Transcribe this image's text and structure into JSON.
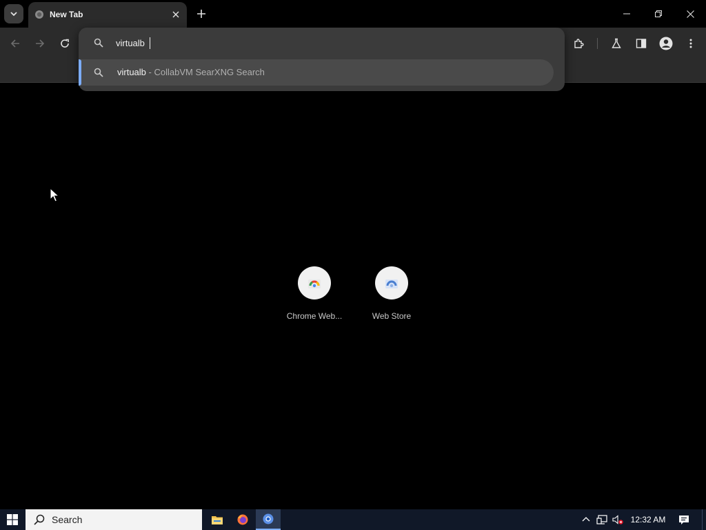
{
  "tabstrip": {
    "tab_title": "New Tab",
    "tab_search_icon": "chevron-down-icon",
    "close_icon": "close-icon",
    "new_tab_icon": "plus-icon"
  },
  "window_controls": [
    "minimize-icon",
    "restore-icon",
    "close-icon"
  ],
  "toolbar": {
    "left_icons": [
      "back-arrow-icon",
      "forward-arrow-icon",
      "reload-icon"
    ],
    "right_icons": [
      "extensions-icon",
      "labs-flask-icon",
      "side-panel-icon",
      "profile-icon",
      "more-menu-icon"
    ]
  },
  "omnibox": {
    "value": "virtualb",
    "suggestions": [
      {
        "query": "virtualb",
        "description": " - CollabVM SearXNG Search",
        "icon": "search-icon"
      }
    ]
  },
  "shortcuts": [
    {
      "label": "Chrome Web...",
      "icon": "chrome-web-store-icon"
    },
    {
      "label": "Web Store",
      "icon": "web-store-icon"
    }
  ],
  "taskbar": {
    "search_placeholder": "Search",
    "apps": [
      "file-explorer-icon",
      "firefox-icon",
      "chrome-icon"
    ],
    "tray": [
      "chevron-up-icon",
      "network-icon",
      "volume-muted-icon"
    ],
    "clock": "12:32 AM"
  },
  "colors": {
    "page_background": "#000000",
    "toolbar": "#2b2b2b",
    "omnibox_popup": "#3b3b3b",
    "suggestion_selected": "#4a4a4a",
    "accent": "#7cacf8",
    "taskbar": "#101828"
  }
}
